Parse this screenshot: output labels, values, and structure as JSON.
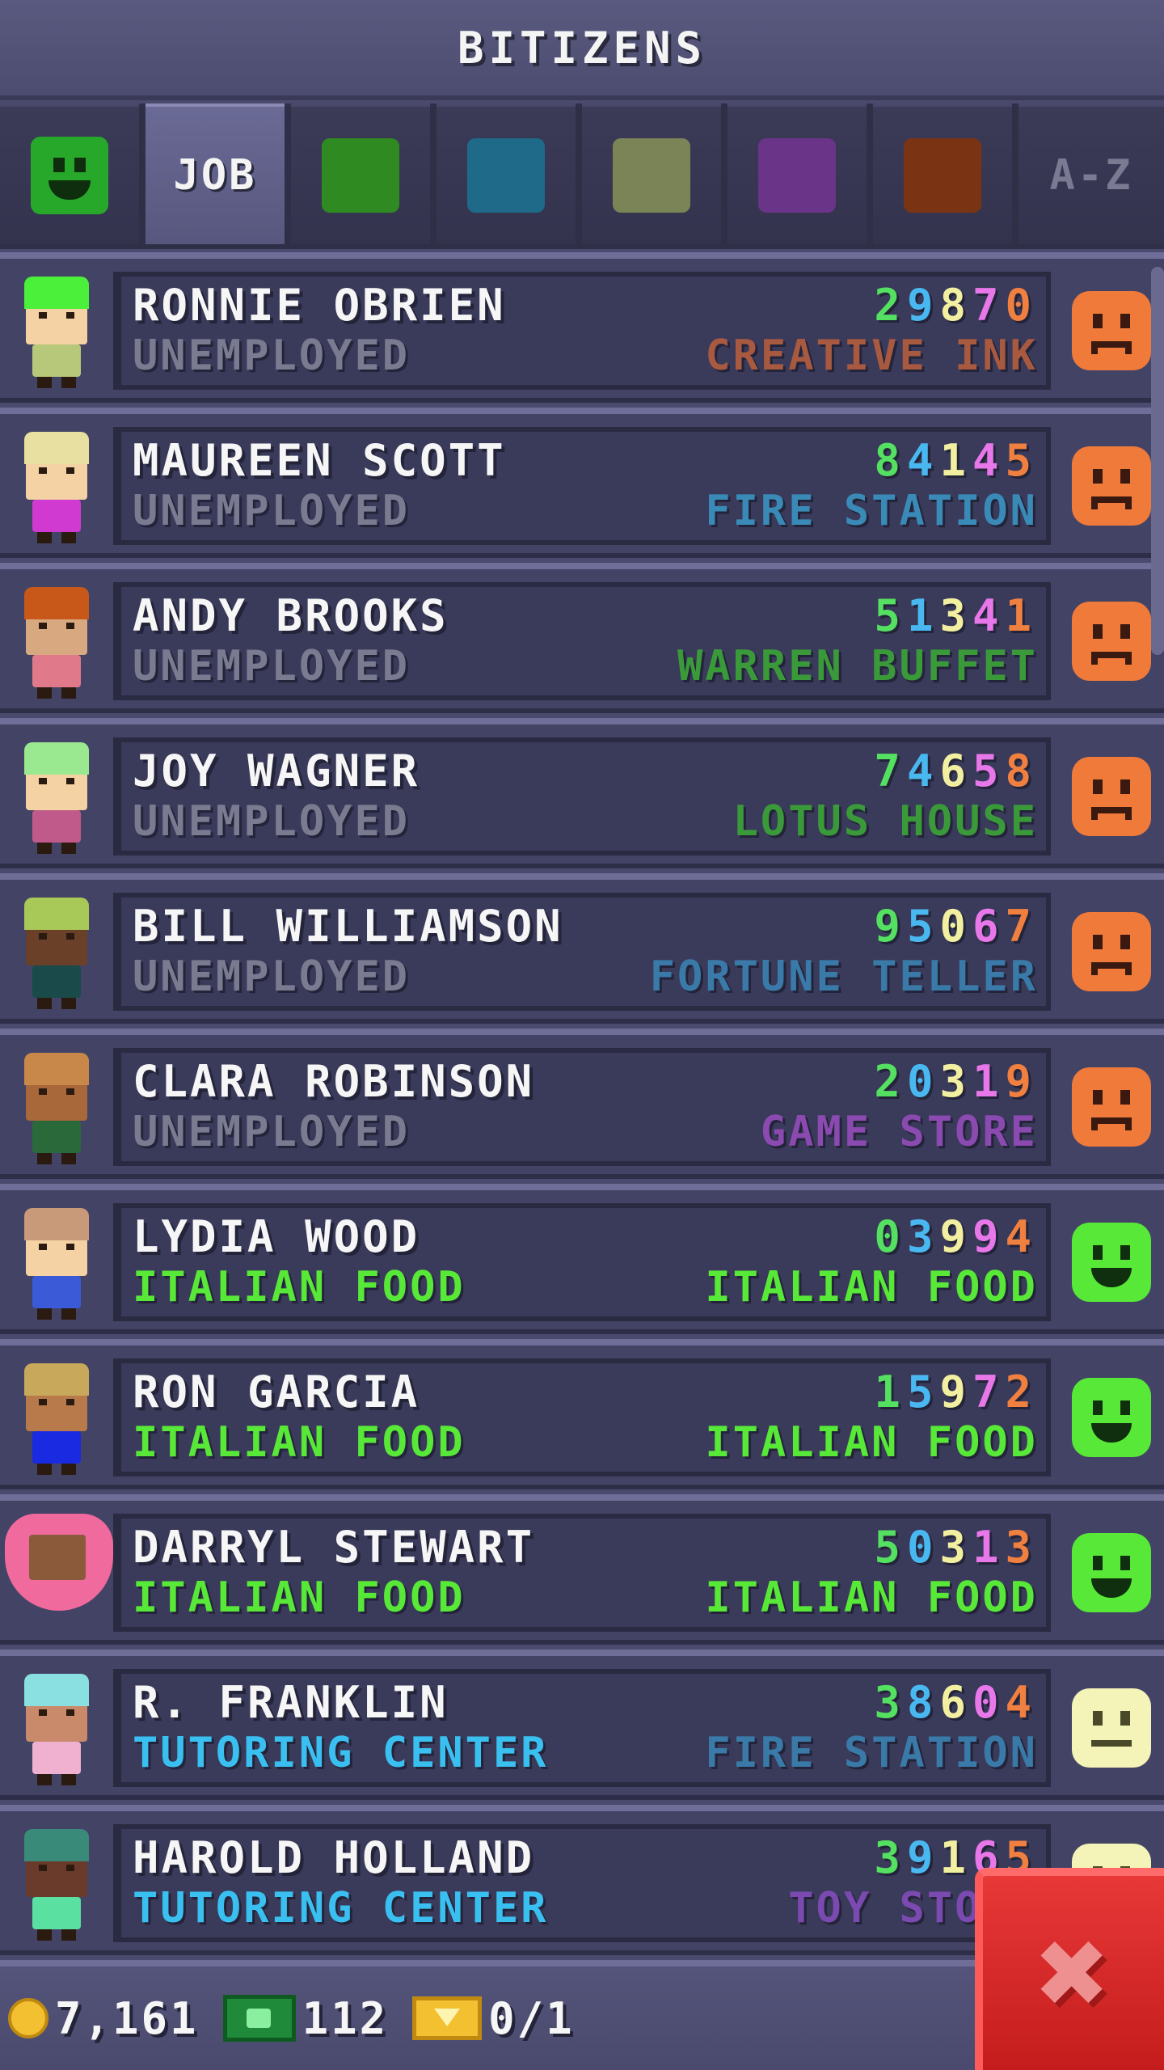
{
  "header": {
    "title": "BITIZENS"
  },
  "tabs": [
    {
      "type": "mood",
      "icon": "happy-face-icon",
      "color": "#28a82a"
    },
    {
      "type": "label",
      "label": "JOB",
      "active": true
    },
    {
      "type": "swatch",
      "color": "#2f8a22"
    },
    {
      "type": "swatch",
      "color": "#1e6a88"
    },
    {
      "type": "swatch",
      "color": "#7a8456"
    },
    {
      "type": "swatch",
      "color": "#6a3488"
    },
    {
      "type": "swatch",
      "color": "#7a3414"
    },
    {
      "type": "label",
      "label": "A-Z",
      "active": false
    }
  ],
  "bitizens": [
    {
      "name": "RONNIE OBRIEN",
      "job": "UNEMPLOYED",
      "job_color": "#7a7a90",
      "code": [
        "2",
        "9",
        "8",
        "7",
        "0"
      ],
      "dream_job": "CREATIVE INK",
      "dream_color": "#a85a40",
      "mood": "sad",
      "hair": "#4af03a",
      "skin": "#f4d2a4",
      "shirt": "#b8c87a"
    },
    {
      "name": "MAUREEN SCOTT",
      "job": "UNEMPLOYED",
      "job_color": "#7a7a90",
      "code": [
        "8",
        "4",
        "1",
        "4",
        "5"
      ],
      "dream_job": "FIRE STATION",
      "dream_color": "#3a8ab8",
      "mood": "sad",
      "hair": "#e8e0a0",
      "skin": "#f4d2a4",
      "shirt": "#d03ad0"
    },
    {
      "name": "ANDY BROOKS",
      "job": "UNEMPLOYED",
      "job_color": "#7a7a90",
      "code": [
        "5",
        "1",
        "3",
        "4",
        "1"
      ],
      "dream_job": "WARREN BUFFET",
      "dream_color": "#3a9a3a",
      "mood": "sad",
      "hair": "#c8581a",
      "skin": "#d8a880",
      "shirt": "#e07a8a"
    },
    {
      "name": "JOY WAGNER",
      "job": "UNEMPLOYED",
      "job_color": "#7a7a90",
      "code": [
        "7",
        "4",
        "6",
        "5",
        "8"
      ],
      "dream_job": "LOTUS HOUSE",
      "dream_color": "#3a9a3a",
      "mood": "sad",
      "hair": "#9ae890",
      "skin": "#f4d2a4",
      "shirt": "#c05a8a"
    },
    {
      "name": "BILL WILLIAMSON",
      "job": "UNEMPLOYED",
      "job_color": "#7a7a90",
      "code": [
        "9",
        "5",
        "0",
        "6",
        "7"
      ],
      "dream_job": "FORTUNE TELLER",
      "dream_color": "#3a7aa8",
      "mood": "sad",
      "hair": "#a8c858",
      "skin": "#6a4028",
      "shirt": "#1a4a4a"
    },
    {
      "name": "CLARA ROBINSON",
      "job": "UNEMPLOYED",
      "job_color": "#7a7a90",
      "code": [
        "2",
        "0",
        "3",
        "1",
        "9"
      ],
      "dream_job": "GAME STORE",
      "dream_color": "#8a4ab0",
      "mood": "sad",
      "hair": "#c8884a",
      "skin": "#a8683a",
      "shirt": "#2a6a3a"
    },
    {
      "name": "LYDIA WOOD",
      "job": "ITALIAN FOOD",
      "job_color": "#58e838",
      "code": [
        "0",
        "3",
        "9",
        "9",
        "4"
      ],
      "dream_job": "ITALIAN FOOD",
      "dream_color": "#58e838",
      "mood": "happy",
      "hair": "#c89a7a",
      "skin": "#f4d2a4",
      "shirt": "#3a5ad8"
    },
    {
      "name": "RON GARCIA",
      "job": "ITALIAN FOOD",
      "job_color": "#58e838",
      "code": [
        "1",
        "5",
        "9",
        "7",
        "2"
      ],
      "dream_job": "ITALIAN FOOD",
      "dream_color": "#58e838",
      "mood": "happy",
      "hair": "#c8a85a",
      "skin": "#b87a4a",
      "shirt": "#1a2ae0"
    },
    {
      "name": "DARRYL STEWART",
      "job": "ITALIAN FOOD",
      "job_color": "#58e838",
      "code": [
        "5",
        "0",
        "3",
        "1",
        "3"
      ],
      "dream_job": "ITALIAN FOOD",
      "dream_color": "#58e838",
      "mood": "happy",
      "hair": "#f06a9e",
      "skin": "#8a5a3a",
      "shirt": "#f06a9e",
      "heart": true
    },
    {
      "name": "R. FRANKLIN",
      "job": "TUTORING CENTER",
      "job_color": "#3ac0f0",
      "code": [
        "3",
        "8",
        "6",
        "0",
        "4"
      ],
      "dream_job": "FIRE STATION",
      "dream_color": "#3a7aa8",
      "mood": "neutral",
      "hair": "#8ae0e0",
      "skin": "#c88a6a",
      "shirt": "#f0b0d0"
    },
    {
      "name": "HAROLD HOLLAND",
      "job": "TUTORING CENTER",
      "job_color": "#3ac0f0",
      "code": [
        "3",
        "9",
        "1",
        "6",
        "5"
      ],
      "dream_job": "TOY STORE",
      "dream_color": "#7a4ab0",
      "mood": "neutral",
      "hair": "#3a8a7a",
      "skin": "#6a3a2a",
      "shirt": "#5ae0a0"
    }
  ],
  "mood_colors": {
    "sad": "#f07a3a",
    "happy": "#58e838",
    "neutral": "#f4f4b8"
  },
  "bottom_bar": {
    "coins": "7,161",
    "bux": "112",
    "vip": "0/1",
    "coin_icon": "coin-icon",
    "bux_icon": "bux-icon",
    "vip_icon": "vip-ticket-icon"
  },
  "close_button": {
    "glyph": "✖",
    "icon": "close-icon"
  }
}
